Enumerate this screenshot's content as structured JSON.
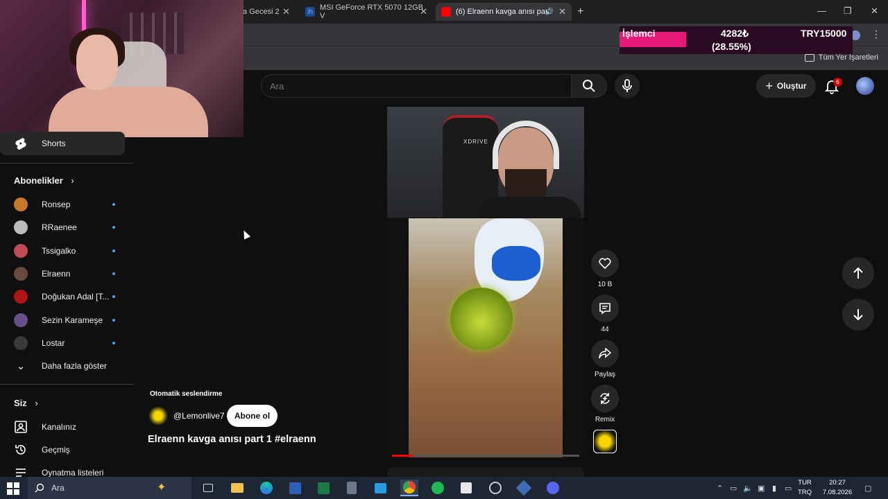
{
  "browser": {
    "tabs": [
      {
        "label": "a Gecesi 2",
        "active": false
      },
      {
        "label": "MSI GeForce RTX 5070 12GB V",
        "active": false
      },
      {
        "label": "(6) Elraenn kavga anısı part",
        "active": true
      }
    ],
    "bookmarks_all": "Tüm Yer İşaretleri"
  },
  "stream_overlay": {
    "label": "İşlemci",
    "count": "4282₺",
    "percent": "(28.55%)",
    "goal": "TRY15000",
    "progress_fraction": 0.2855,
    "accent": "#e5197a"
  },
  "header": {
    "search_placeholder": "Ara",
    "create_label": "Oluştur",
    "notification_count": "6"
  },
  "sidebar": {
    "shorts_label": "Shorts",
    "subscriptions_title": "Abonelikler",
    "subscriptions": [
      {
        "name": "Ronsep",
        "color": "#c9772a"
      },
      {
        "name": "RRaenee",
        "color": "#bbbbbb"
      },
      {
        "name": "Tssigalko",
        "color": "#c04a55"
      },
      {
        "name": "Elraenn",
        "color": "#6a4a3c"
      },
      {
        "name": "Doğukan Adal [T...",
        "color": "#b01515"
      },
      {
        "name": "Sezin Karameşe",
        "color": "#6a4e8a"
      },
      {
        "name": "Lostar",
        "color": "#3a3a3a"
      }
    ],
    "show_more": "Daha fazla göster",
    "you_title": "Siz",
    "you_items": [
      {
        "label": "Kanalınız",
        "icon": "channel-icon"
      },
      {
        "label": "Geçmiş",
        "icon": "history-icon"
      },
      {
        "label": "Oynatma listeleri",
        "icon": "playlist-icon"
      }
    ]
  },
  "short": {
    "auto_dub": "Otomatik seslendirme",
    "channel": "@Lemonlive7",
    "subscribe": "Abone ol",
    "title": "Elraenn kavga anısı part 1 #elraenn",
    "video_chair_text": "XDRIVE",
    "progress_fraction": 0.11,
    "actions": {
      "likes": "10 B",
      "comments": "44",
      "share": "Paylaş",
      "remix": "Remix"
    }
  },
  "taskbar": {
    "search_label": "Ara",
    "lang_top": "TUR",
    "lang_bottom": "TRQ",
    "time": "20:27",
    "date": "7.08.2026"
  }
}
